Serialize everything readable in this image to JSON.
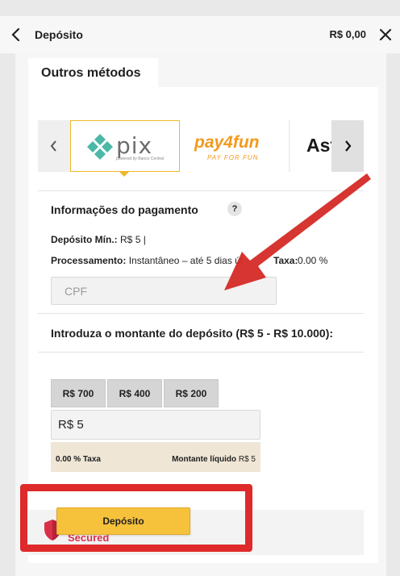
{
  "header": {
    "title": "Depósito",
    "balance": "R$ 0,00"
  },
  "tab": {
    "label": "Outros métodos"
  },
  "methods": [
    {
      "name": "pix",
      "logo": "pix",
      "sub": "powered by Banco Central"
    },
    {
      "name": "pay4fun",
      "logo": "pay4fun",
      "sub": "PAY FOR FUN"
    },
    {
      "name": "astropay",
      "logo": "Ast"
    }
  ],
  "payment_info": {
    "title": "Informações do pagamento",
    "help": "?",
    "min_label": "Depósito Mín.:",
    "min_value": "R$ 5",
    "separator": "|",
    "processing_label": "Processamento:",
    "processing_value": "Instantâneo – até 5 dias út",
    "fee_label": "Taxa:",
    "fee_value": "0.00 %"
  },
  "cpf": {
    "placeholder": "CPF"
  },
  "amount_section": {
    "title": "Introduza o montante do depósito (R$ 5 - R$ 10.000):",
    "quick_amounts": [
      "R$ 700",
      "R$ 400",
      "R$ 200"
    ],
    "value": "R$ 5",
    "fee_text": "0.00 % Taxa",
    "net_label": "Montante líquido",
    "net_value": "R$ 5"
  },
  "deposit_button": {
    "label": "Depósito"
  },
  "secured_text": "Secured",
  "colors": {
    "accent": "#f7c23b",
    "highlight_red": "#de2a2a",
    "pay4fun": "#f29a1c",
    "pix_teal": "#4cb8a8"
  }
}
